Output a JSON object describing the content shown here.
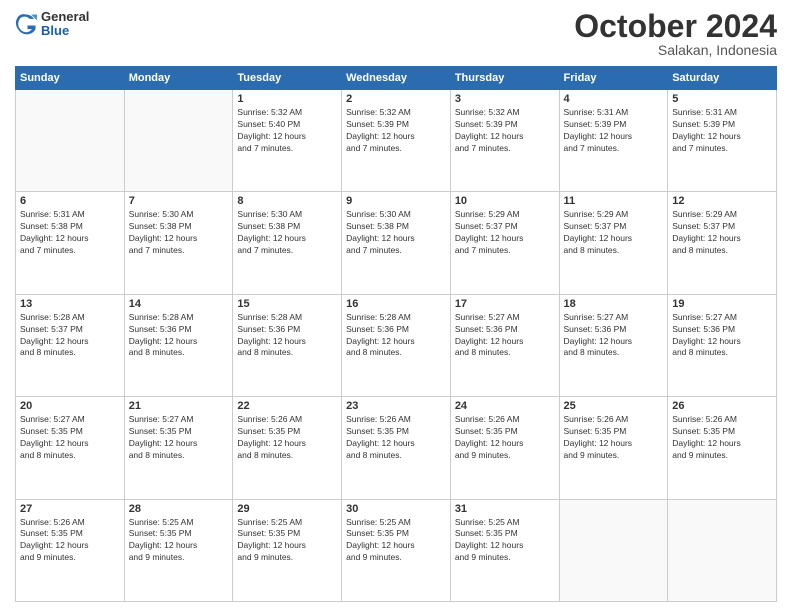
{
  "logo": {
    "general": "General",
    "blue": "Blue"
  },
  "title": {
    "month": "October 2024",
    "location": "Salakan, Indonesia"
  },
  "weekdays": [
    "Sunday",
    "Monday",
    "Tuesday",
    "Wednesday",
    "Thursday",
    "Friday",
    "Saturday"
  ],
  "weeks": [
    [
      {
        "day": "",
        "info": ""
      },
      {
        "day": "",
        "info": ""
      },
      {
        "day": "1",
        "info": "Sunrise: 5:32 AM\nSunset: 5:40 PM\nDaylight: 12 hours\nand 7 minutes."
      },
      {
        "day": "2",
        "info": "Sunrise: 5:32 AM\nSunset: 5:39 PM\nDaylight: 12 hours\nand 7 minutes."
      },
      {
        "day": "3",
        "info": "Sunrise: 5:32 AM\nSunset: 5:39 PM\nDaylight: 12 hours\nand 7 minutes."
      },
      {
        "day": "4",
        "info": "Sunrise: 5:31 AM\nSunset: 5:39 PM\nDaylight: 12 hours\nand 7 minutes."
      },
      {
        "day": "5",
        "info": "Sunrise: 5:31 AM\nSunset: 5:39 PM\nDaylight: 12 hours\nand 7 minutes."
      }
    ],
    [
      {
        "day": "6",
        "info": "Sunrise: 5:31 AM\nSunset: 5:38 PM\nDaylight: 12 hours\nand 7 minutes."
      },
      {
        "day": "7",
        "info": "Sunrise: 5:30 AM\nSunset: 5:38 PM\nDaylight: 12 hours\nand 7 minutes."
      },
      {
        "day": "8",
        "info": "Sunrise: 5:30 AM\nSunset: 5:38 PM\nDaylight: 12 hours\nand 7 minutes."
      },
      {
        "day": "9",
        "info": "Sunrise: 5:30 AM\nSunset: 5:38 PM\nDaylight: 12 hours\nand 7 minutes."
      },
      {
        "day": "10",
        "info": "Sunrise: 5:29 AM\nSunset: 5:37 PM\nDaylight: 12 hours\nand 7 minutes."
      },
      {
        "day": "11",
        "info": "Sunrise: 5:29 AM\nSunset: 5:37 PM\nDaylight: 12 hours\nand 8 minutes."
      },
      {
        "day": "12",
        "info": "Sunrise: 5:29 AM\nSunset: 5:37 PM\nDaylight: 12 hours\nand 8 minutes."
      }
    ],
    [
      {
        "day": "13",
        "info": "Sunrise: 5:28 AM\nSunset: 5:37 PM\nDaylight: 12 hours\nand 8 minutes."
      },
      {
        "day": "14",
        "info": "Sunrise: 5:28 AM\nSunset: 5:36 PM\nDaylight: 12 hours\nand 8 minutes."
      },
      {
        "day": "15",
        "info": "Sunrise: 5:28 AM\nSunset: 5:36 PM\nDaylight: 12 hours\nand 8 minutes."
      },
      {
        "day": "16",
        "info": "Sunrise: 5:28 AM\nSunset: 5:36 PM\nDaylight: 12 hours\nand 8 minutes."
      },
      {
        "day": "17",
        "info": "Sunrise: 5:27 AM\nSunset: 5:36 PM\nDaylight: 12 hours\nand 8 minutes."
      },
      {
        "day": "18",
        "info": "Sunrise: 5:27 AM\nSunset: 5:36 PM\nDaylight: 12 hours\nand 8 minutes."
      },
      {
        "day": "19",
        "info": "Sunrise: 5:27 AM\nSunset: 5:36 PM\nDaylight: 12 hours\nand 8 minutes."
      }
    ],
    [
      {
        "day": "20",
        "info": "Sunrise: 5:27 AM\nSunset: 5:35 PM\nDaylight: 12 hours\nand 8 minutes."
      },
      {
        "day": "21",
        "info": "Sunrise: 5:27 AM\nSunset: 5:35 PM\nDaylight: 12 hours\nand 8 minutes."
      },
      {
        "day": "22",
        "info": "Sunrise: 5:26 AM\nSunset: 5:35 PM\nDaylight: 12 hours\nand 8 minutes."
      },
      {
        "day": "23",
        "info": "Sunrise: 5:26 AM\nSunset: 5:35 PM\nDaylight: 12 hours\nand 8 minutes."
      },
      {
        "day": "24",
        "info": "Sunrise: 5:26 AM\nSunset: 5:35 PM\nDaylight: 12 hours\nand 9 minutes."
      },
      {
        "day": "25",
        "info": "Sunrise: 5:26 AM\nSunset: 5:35 PM\nDaylight: 12 hours\nand 9 minutes."
      },
      {
        "day": "26",
        "info": "Sunrise: 5:26 AM\nSunset: 5:35 PM\nDaylight: 12 hours\nand 9 minutes."
      }
    ],
    [
      {
        "day": "27",
        "info": "Sunrise: 5:26 AM\nSunset: 5:35 PM\nDaylight: 12 hours\nand 9 minutes."
      },
      {
        "day": "28",
        "info": "Sunrise: 5:25 AM\nSunset: 5:35 PM\nDaylight: 12 hours\nand 9 minutes."
      },
      {
        "day": "29",
        "info": "Sunrise: 5:25 AM\nSunset: 5:35 PM\nDaylight: 12 hours\nand 9 minutes."
      },
      {
        "day": "30",
        "info": "Sunrise: 5:25 AM\nSunset: 5:35 PM\nDaylight: 12 hours\nand 9 minutes."
      },
      {
        "day": "31",
        "info": "Sunrise: 5:25 AM\nSunset: 5:35 PM\nDaylight: 12 hours\nand 9 minutes."
      },
      {
        "day": "",
        "info": ""
      },
      {
        "day": "",
        "info": ""
      }
    ]
  ]
}
